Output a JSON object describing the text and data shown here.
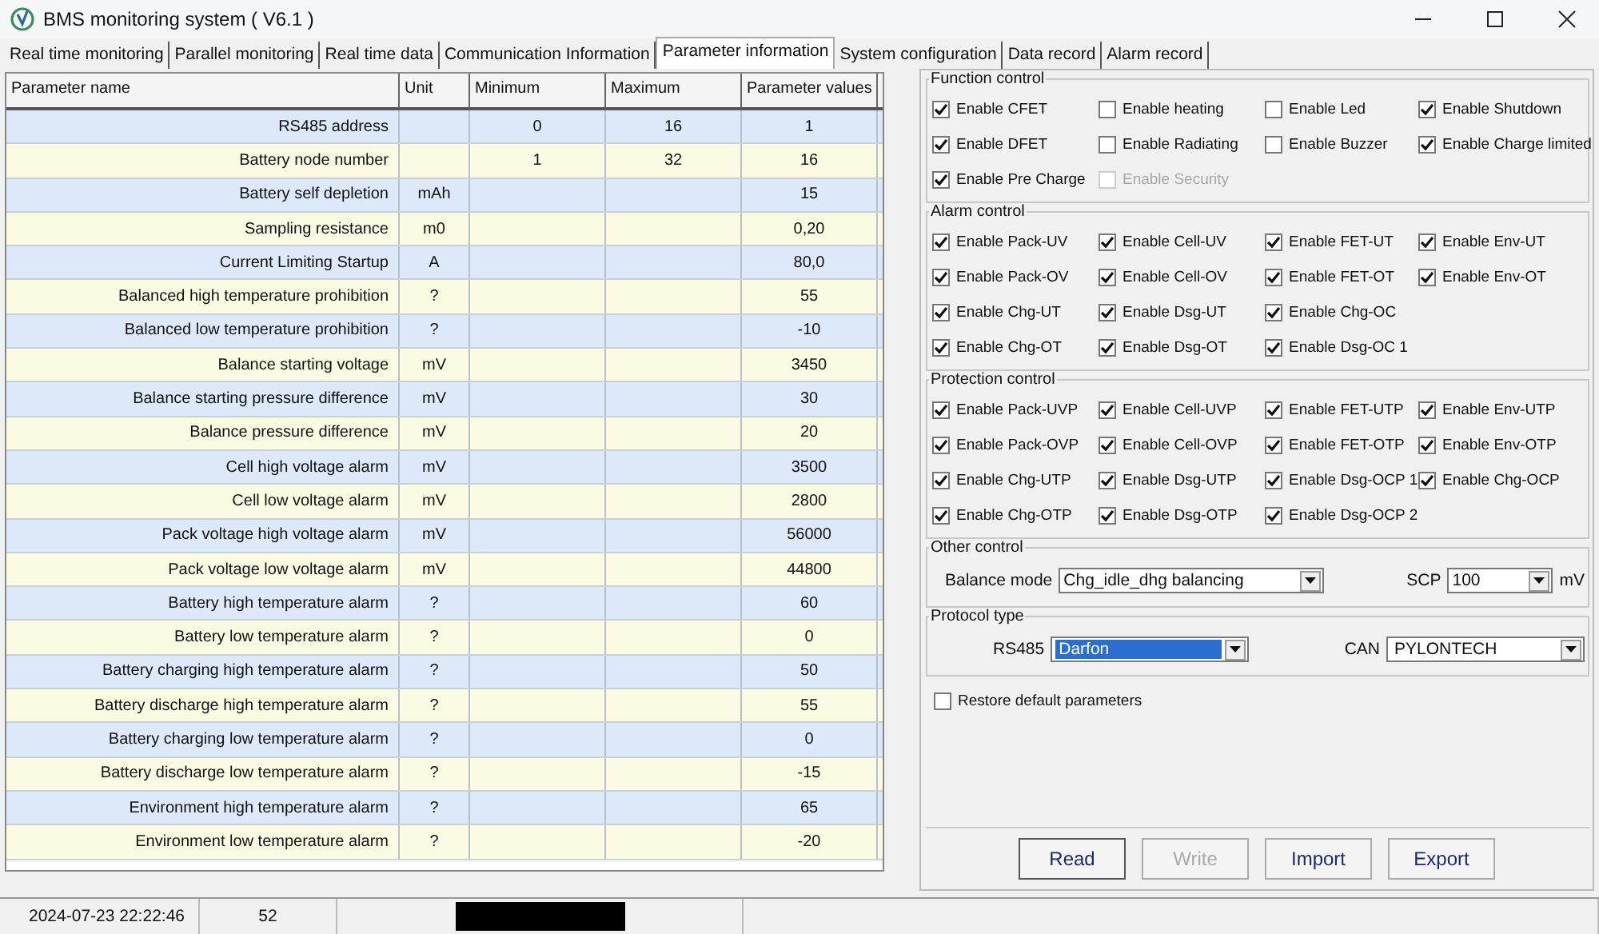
{
  "window": {
    "title": "BMS monitoring system  ( V6.1 )"
  },
  "tabs": [
    {
      "label": "Real time monitoring",
      "selected": false
    },
    {
      "label": "Parallel monitoring",
      "selected": false
    },
    {
      "label": "Real time data",
      "selected": false
    },
    {
      "label": "Communication Information",
      "selected": false
    },
    {
      "label": "Parameter information",
      "selected": true
    },
    {
      "label": "System configuration",
      "selected": false
    },
    {
      "label": "Data record",
      "selected": false
    },
    {
      "label": "Alarm record",
      "selected": false
    }
  ],
  "table": {
    "columns": [
      "Parameter name",
      "Unit",
      "Minimum",
      "Maximum",
      "Parameter values"
    ],
    "rows": [
      [
        "RS485 address",
        "",
        "0",
        "16",
        "1"
      ],
      [
        "Battery node number",
        "",
        "1",
        "32",
        "16"
      ],
      [
        "Battery self depletion",
        "mAh",
        "",
        "",
        "15"
      ],
      [
        "Sampling resistance",
        "m0",
        "",
        "",
        "0,20"
      ],
      [
        "Current Limiting Startup",
        "A",
        "",
        "",
        "80,0"
      ],
      [
        "Balanced high temperature prohibition",
        "?",
        "",
        "",
        "55"
      ],
      [
        "Balanced low temperature prohibition",
        "?",
        "",
        "",
        "-10"
      ],
      [
        "Balance starting voltage",
        "mV",
        "",
        "",
        "3450"
      ],
      [
        "Balance starting pressure difference",
        "mV",
        "",
        "",
        "30"
      ],
      [
        "Balance pressure difference",
        "mV",
        "",
        "",
        "20"
      ],
      [
        "Cell high voltage alarm",
        "mV",
        "",
        "",
        "3500"
      ],
      [
        "Cell low voltage alarm",
        "mV",
        "",
        "",
        "2800"
      ],
      [
        "Pack voltage high voltage alarm",
        "mV",
        "",
        "",
        "56000"
      ],
      [
        "Pack voltage low voltage alarm",
        "mV",
        "",
        "",
        "44800"
      ],
      [
        "Battery high temperature alarm",
        "?",
        "",
        "",
        "60"
      ],
      [
        "Battery low temperature alarm",
        "?",
        "",
        "",
        "0"
      ],
      [
        "Battery charging high temperature alarm",
        "?",
        "",
        "",
        "50"
      ],
      [
        "Battery discharge high temperature alarm",
        "?",
        "",
        "",
        "55"
      ],
      [
        "Battery charging low temperature alarm",
        "?",
        "",
        "",
        "0"
      ],
      [
        "Battery discharge low temperature alarm",
        "?",
        "",
        "",
        "-15"
      ],
      [
        "Environment high temperature alarm",
        "?",
        "",
        "",
        "65"
      ],
      [
        "Environment low temperature alarm",
        "?",
        "",
        "",
        "-20"
      ]
    ]
  },
  "groups": [
    {
      "title": "Function control",
      "items": [
        {
          "label": "Enable CFET",
          "checked": true,
          "disabled": false
        },
        {
          "label": "Enable heating",
          "checked": false,
          "disabled": false
        },
        {
          "label": "Enable Led",
          "checked": false,
          "disabled": false
        },
        {
          "label": "Enable Shutdown",
          "checked": true,
          "disabled": false
        },
        {
          "label": "Enable DFET",
          "checked": true,
          "disabled": false
        },
        {
          "label": "Enable  Radiating",
          "checked": false,
          "disabled": false
        },
        {
          "label": "Enable Buzzer",
          "checked": false,
          "disabled": false
        },
        {
          "label": "Enable Charge limited",
          "checked": true,
          "disabled": false
        },
        {
          "label": "Enable Pre Charge",
          "checked": true,
          "disabled": false
        },
        {
          "label": "Enable Security",
          "checked": false,
          "disabled": true
        }
      ]
    },
    {
      "title": "Alarm control",
      "items": [
        {
          "label": "Enable Pack-UV",
          "checked": true
        },
        {
          "label": "Enable Cell-UV",
          "checked": true
        },
        {
          "label": "Enable FET-UT",
          "checked": true
        },
        {
          "label": "Enable Env-UT",
          "checked": true
        },
        {
          "label": "Enable Pack-OV",
          "checked": true
        },
        {
          "label": "Enable Cell-OV",
          "checked": true
        },
        {
          "label": "Enable FET-OT",
          "checked": true
        },
        {
          "label": "Enable Env-OT",
          "checked": true
        },
        {
          "label": "Enable Chg-UT",
          "checked": true
        },
        {
          "label": "Enable Dsg-UT",
          "checked": true
        },
        {
          "label": "Enable Chg-OC",
          "checked": true
        },
        {
          "label": "Enable Chg-OT",
          "checked": true
        },
        {
          "label": "Enable Dsg-OT",
          "checked": true
        },
        {
          "label": "Enable Dsg-OC 1",
          "checked": true
        }
      ]
    },
    {
      "title": "Protection control",
      "items": [
        {
          "label": "Enable Pack-UVP",
          "checked": true
        },
        {
          "label": "Enable Cell-UVP",
          "checked": true
        },
        {
          "label": "Enable FET-UTP",
          "checked": true
        },
        {
          "label": "Enable Env-UTP",
          "checked": true
        },
        {
          "label": "Enable Pack-OVP",
          "checked": true
        },
        {
          "label": "Enable Cell-OVP",
          "checked": true
        },
        {
          "label": "Enable FET-OTP",
          "checked": true
        },
        {
          "label": "Enable Env-OTP",
          "checked": true
        },
        {
          "label": "Enable Chg-UTP",
          "checked": true
        },
        {
          "label": "Enable Dsg-UTP",
          "checked": true
        },
        {
          "label": "Enable Dsg-OCP 1",
          "checked": true
        },
        {
          "label": "Enable Chg-OCP",
          "checked": true
        },
        {
          "label": "Enable Chg-OTP",
          "checked": true
        },
        {
          "label": "Enable Dsg-OTP",
          "checked": true
        },
        {
          "label": "Enable Dsg-OCP 2",
          "checked": true
        }
      ]
    }
  ],
  "other_control": {
    "title": "Other control",
    "balance_mode": {
      "label": "Balance mode",
      "value": "Chg_idle_dhg balancing"
    },
    "scp": {
      "label": "SCP",
      "value": "100",
      "unit": "mV"
    }
  },
  "protocol_type": {
    "title": "Protocol type",
    "rs485": {
      "label": "RS485",
      "value": "Darfon",
      "selected": true
    },
    "can": {
      "label": "CAN",
      "value": "PYLONTECH",
      "selected": false
    }
  },
  "restore_default": {
    "label": "Restore default parameters",
    "checked": false
  },
  "buttons": [
    {
      "label": "Read",
      "disabled": false
    },
    {
      "label": "Write",
      "disabled": true
    },
    {
      "label": "Import",
      "disabled": false
    },
    {
      "label": "Export",
      "disabled": false
    }
  ],
  "status_bar": [
    "2024-07-23 22:22:46",
    "52"
  ]
}
